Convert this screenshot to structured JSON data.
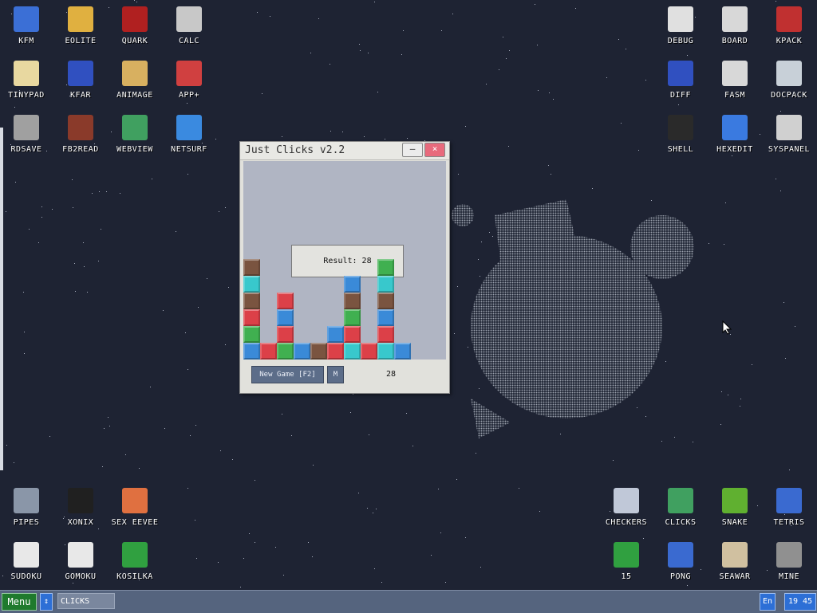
{
  "desktop": {
    "icons_top_left": [
      {
        "label": "KFM",
        "icon": "floppy-icon",
        "color": "#3b6fd6"
      },
      {
        "label": "EOLITE",
        "icon": "folder-icon",
        "color": "#e0b040"
      },
      {
        "label": "QUARK",
        "icon": "notebook-icon",
        "color": "#b02020"
      },
      {
        "label": "CALC",
        "icon": "calculator-icon",
        "color": "#c8c8c8"
      },
      {
        "label": "TINYPAD",
        "icon": "notepad-icon",
        "color": "#e8d8a0"
      },
      {
        "label": "KFAR",
        "icon": "archive-icon",
        "color": "#3050c0"
      },
      {
        "label": "ANIMAGE",
        "icon": "paint-tools-icon",
        "color": "#d8b060"
      },
      {
        "label": "APP+",
        "icon": "cube-icon",
        "color": "#d04040"
      },
      {
        "label": "RDSAVE",
        "icon": "save-disk-icon",
        "color": "#a0a0a0"
      },
      {
        "label": "FB2READ",
        "icon": "book-icon",
        "color": "#8a3a2a"
      },
      {
        "label": "WEBVIEW",
        "icon": "webview-icon",
        "color": "#40a060"
      },
      {
        "label": "NETSURF",
        "icon": "globe-icon",
        "color": "#3a8ae0"
      }
    ],
    "icons_top_right": [
      {
        "label": "DEBUG",
        "icon": "debug-icon",
        "color": "#e0e0e0"
      },
      {
        "label": "BOARD",
        "icon": "board-icon",
        "color": "#d8d8d8"
      },
      {
        "label": "KPACK",
        "icon": "wrench-icon",
        "color": "#c03030"
      },
      {
        "label": "DIFF",
        "icon": "diff-icon",
        "color": "#3050c0"
      },
      {
        "label": "FASM",
        "icon": "fasm-icon",
        "color": "#d8d8d8"
      },
      {
        "label": "DOCPACK",
        "icon": "cabinet-icon",
        "color": "#c8d0d8"
      },
      {
        "label": "SHELL",
        "icon": "terminal-icon",
        "color": "#2a2a2a"
      },
      {
        "label": "HEXEDIT",
        "icon": "hex-icon",
        "color": "#3a7ae0"
      },
      {
        "label": "SYSPANEL",
        "icon": "sliders-icon",
        "color": "#d0d0d0"
      }
    ],
    "icons_bottom_left": [
      {
        "label": "PIPES",
        "icon": "pipes-icon",
        "color": "#8a96a8"
      },
      {
        "label": "XONIX",
        "icon": "xonix-icon",
        "color": "#202020"
      },
      {
        "label": "SEX EEVEE",
        "icon": "color-grid-icon",
        "color": "#e07040"
      },
      {
        "label": "SUDOKU",
        "icon": "sudoku-icon",
        "color": "#e8e8e8"
      },
      {
        "label": "GOMOKU",
        "icon": "gomoku-icon",
        "color": "#e8e8e8"
      },
      {
        "label": "KOSILKA",
        "icon": "mower-icon",
        "color": "#30a040"
      }
    ],
    "icons_bottom_right": [
      {
        "label": "CHECKERS",
        "icon": "checkers-icon",
        "color": "#c0c8d8"
      },
      {
        "label": "CLICKS",
        "icon": "clicks-icon",
        "color": "#40a060"
      },
      {
        "label": "SNAKE",
        "icon": "snake-icon",
        "color": "#60b030"
      },
      {
        "label": "TETRIS",
        "icon": "tetris-icon",
        "color": "#3a6ad0"
      },
      {
        "label": "15",
        "icon": "fifteen-icon",
        "color": "#30a040"
      },
      {
        "label": "PONG",
        "icon": "pong-icon",
        "color": "#3a6ad0"
      },
      {
        "label": "SEAWAR",
        "icon": "ship-icon",
        "color": "#d0c0a0"
      },
      {
        "label": "MINE",
        "icon": "mine-icon",
        "color": "#909090"
      }
    ]
  },
  "window": {
    "title": "Just Clicks v2.2",
    "minimize_label": "–",
    "close_label": "×",
    "result_text": "Result: 28",
    "new_game_label": "New Game [F2]",
    "m_label": "M",
    "score": "28",
    "colors": {
      "brown": "#7a5440",
      "cyan": "#38c8cc",
      "red": "#dc4048",
      "green": "#40b050",
      "blue": "#3a8ad8"
    },
    "columns": [
      [
        "blue",
        "green",
        "red",
        "brown",
        "cyan",
        "brown"
      ],
      [
        "red"
      ],
      [
        "green",
        "red",
        "blue",
        "red"
      ],
      [
        "blue"
      ],
      [
        "brown"
      ],
      [
        "red",
        "blue"
      ],
      [
        "cyan",
        "red",
        "green",
        "brown",
        "blue"
      ],
      [
        "red"
      ],
      [
        "cyan",
        "red",
        "blue",
        "brown",
        "cyan",
        "green"
      ],
      [
        "blue"
      ]
    ]
  },
  "taskbar": {
    "menu_label": "Menu",
    "arrow_label": "↕",
    "task_label": "CLICKS",
    "lang_label": "En",
    "clock": "19 45"
  }
}
